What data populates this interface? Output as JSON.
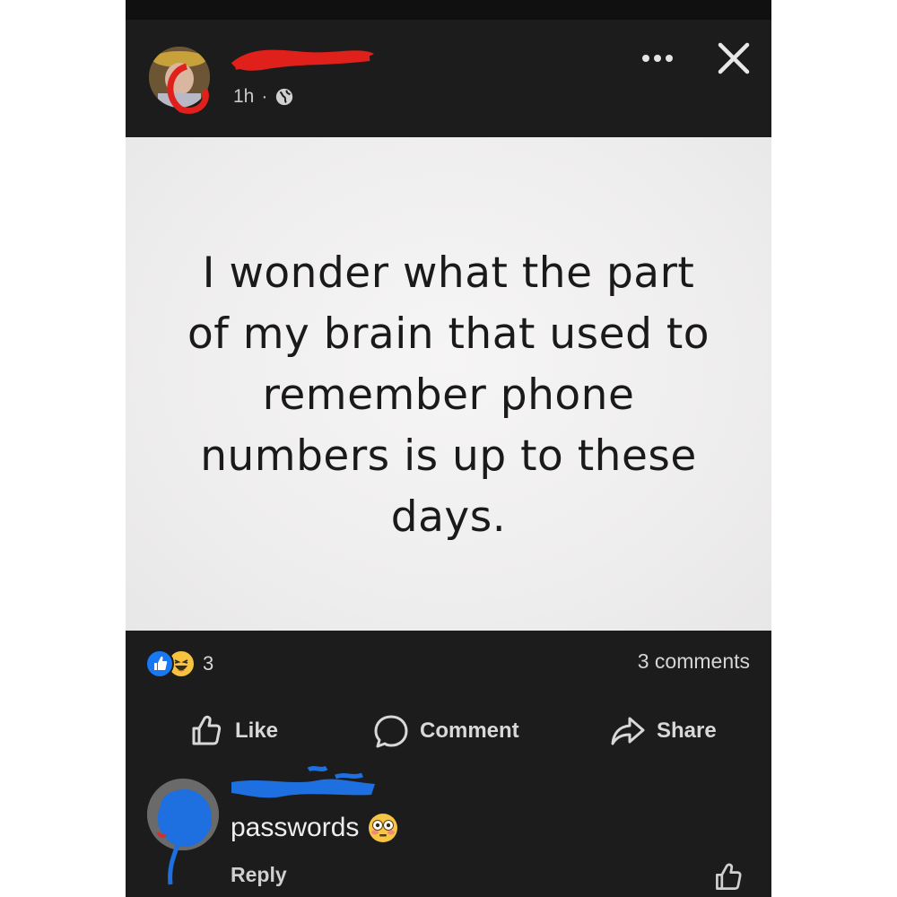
{
  "post": {
    "time": "1h",
    "separator": "·",
    "icons": {
      "privacy": "globe-icon",
      "more": "more-options-icon",
      "close": "close-icon"
    },
    "image_text": [
      "I wonder what the part",
      "of my brain that used to",
      "remember phone",
      "numbers is up to these",
      "days."
    ]
  },
  "engagement": {
    "reaction_icons": [
      "like-reaction-icon",
      "haha-reaction-icon"
    ],
    "reaction_count": "3",
    "comments_count": "3 comments"
  },
  "actions": {
    "like_label": "Like",
    "comment_label": "Comment",
    "share_label": "Share"
  },
  "comment": {
    "text": "passwords",
    "emoji_icon": "flushed-face-icon",
    "reply_label": "Reply"
  },
  "colors": {
    "background": "#1c1c1d",
    "text": "#d8d8d8",
    "like_blue": "#1877f2",
    "redaction_red": "#e0201b",
    "redaction_blue": "#1e6fe0"
  }
}
